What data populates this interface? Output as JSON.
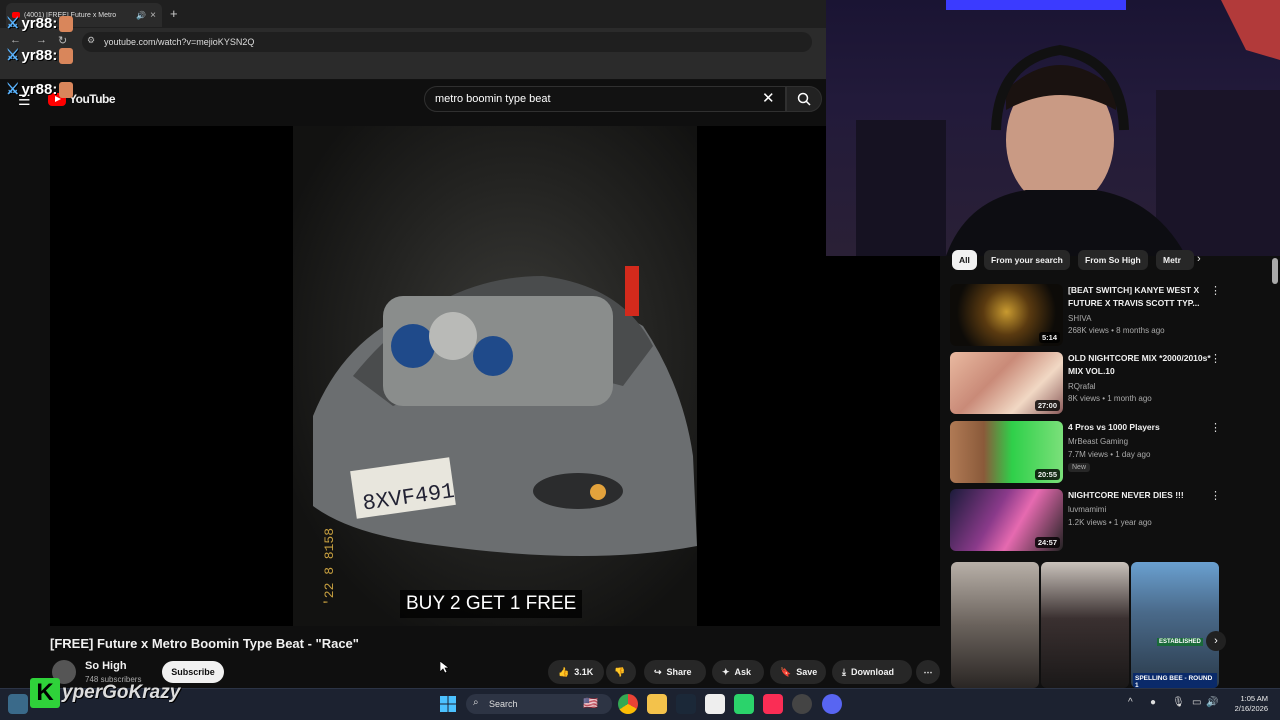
{
  "browser": {
    "tab_title": "(4001) [FREE] Future x Metro",
    "url": "youtube.com/watch?v=mejioKYSN2Q"
  },
  "chat_overlay": {
    "lines": [
      "yr88:",
      "yr88:",
      "yr88:"
    ]
  },
  "youtube": {
    "logo_text": "YouTube",
    "search_query": "metro boomin type beat",
    "video": {
      "caption": "BUY 2 GET 1 FREE",
      "title": "[FREE] Future x Metro Boomin Type Beat - \"Race\"",
      "channel": "So High",
      "subscribers": "748 subscribers",
      "subscribe_label": "Subscribe",
      "likes": "3.1K",
      "share_label": "Share",
      "ask_label": "Ask",
      "save_label": "Save",
      "download_label": "Download"
    },
    "chips": [
      "All",
      "From your search",
      "From So High",
      "Metr"
    ],
    "recommendations": [
      {
        "title": "[BEAT SWITCH] KANYE WEST X FUTURE X TRAVIS SCOTT TYP...",
        "channel": "SHIVA",
        "meta": "268K views • 8 months ago",
        "duration": "5:14",
        "badge": ""
      },
      {
        "title": "OLD NIGHTCORE MIX *2000/2010s* MIX VOL.10",
        "channel": "RQrafal",
        "meta": "8K views • 1 month ago",
        "duration": "27:00",
        "badge": ""
      },
      {
        "title": "4 Pros vs 1000 Players",
        "channel": "MrBeast Gaming",
        "meta": "7.7M views • 1 day ago",
        "duration": "20:55",
        "badge": "New"
      },
      {
        "title": "NIGHTCORE NEVER DIES !!!",
        "channel": "luvmamimi",
        "meta": "1.2K views • 1 year ago",
        "duration": "24:57",
        "badge": ""
      }
    ],
    "shorts_overlay_text": [
      "ESTABLISHED",
      "SPELLING BEE - ROUND 1"
    ]
  },
  "streamer_overlay": {
    "name": "yperGoKrazy",
    "logo_letter": "K"
  },
  "taskbar": {
    "search_label": "Search",
    "time": "1:05 AM",
    "date": "2/16/2026"
  },
  "colors": {
    "bg": "#0f0f0f",
    "youtube_red": "#ff0000",
    "kyper_green": "#2fd23a",
    "taskbar": "#1c2230"
  }
}
